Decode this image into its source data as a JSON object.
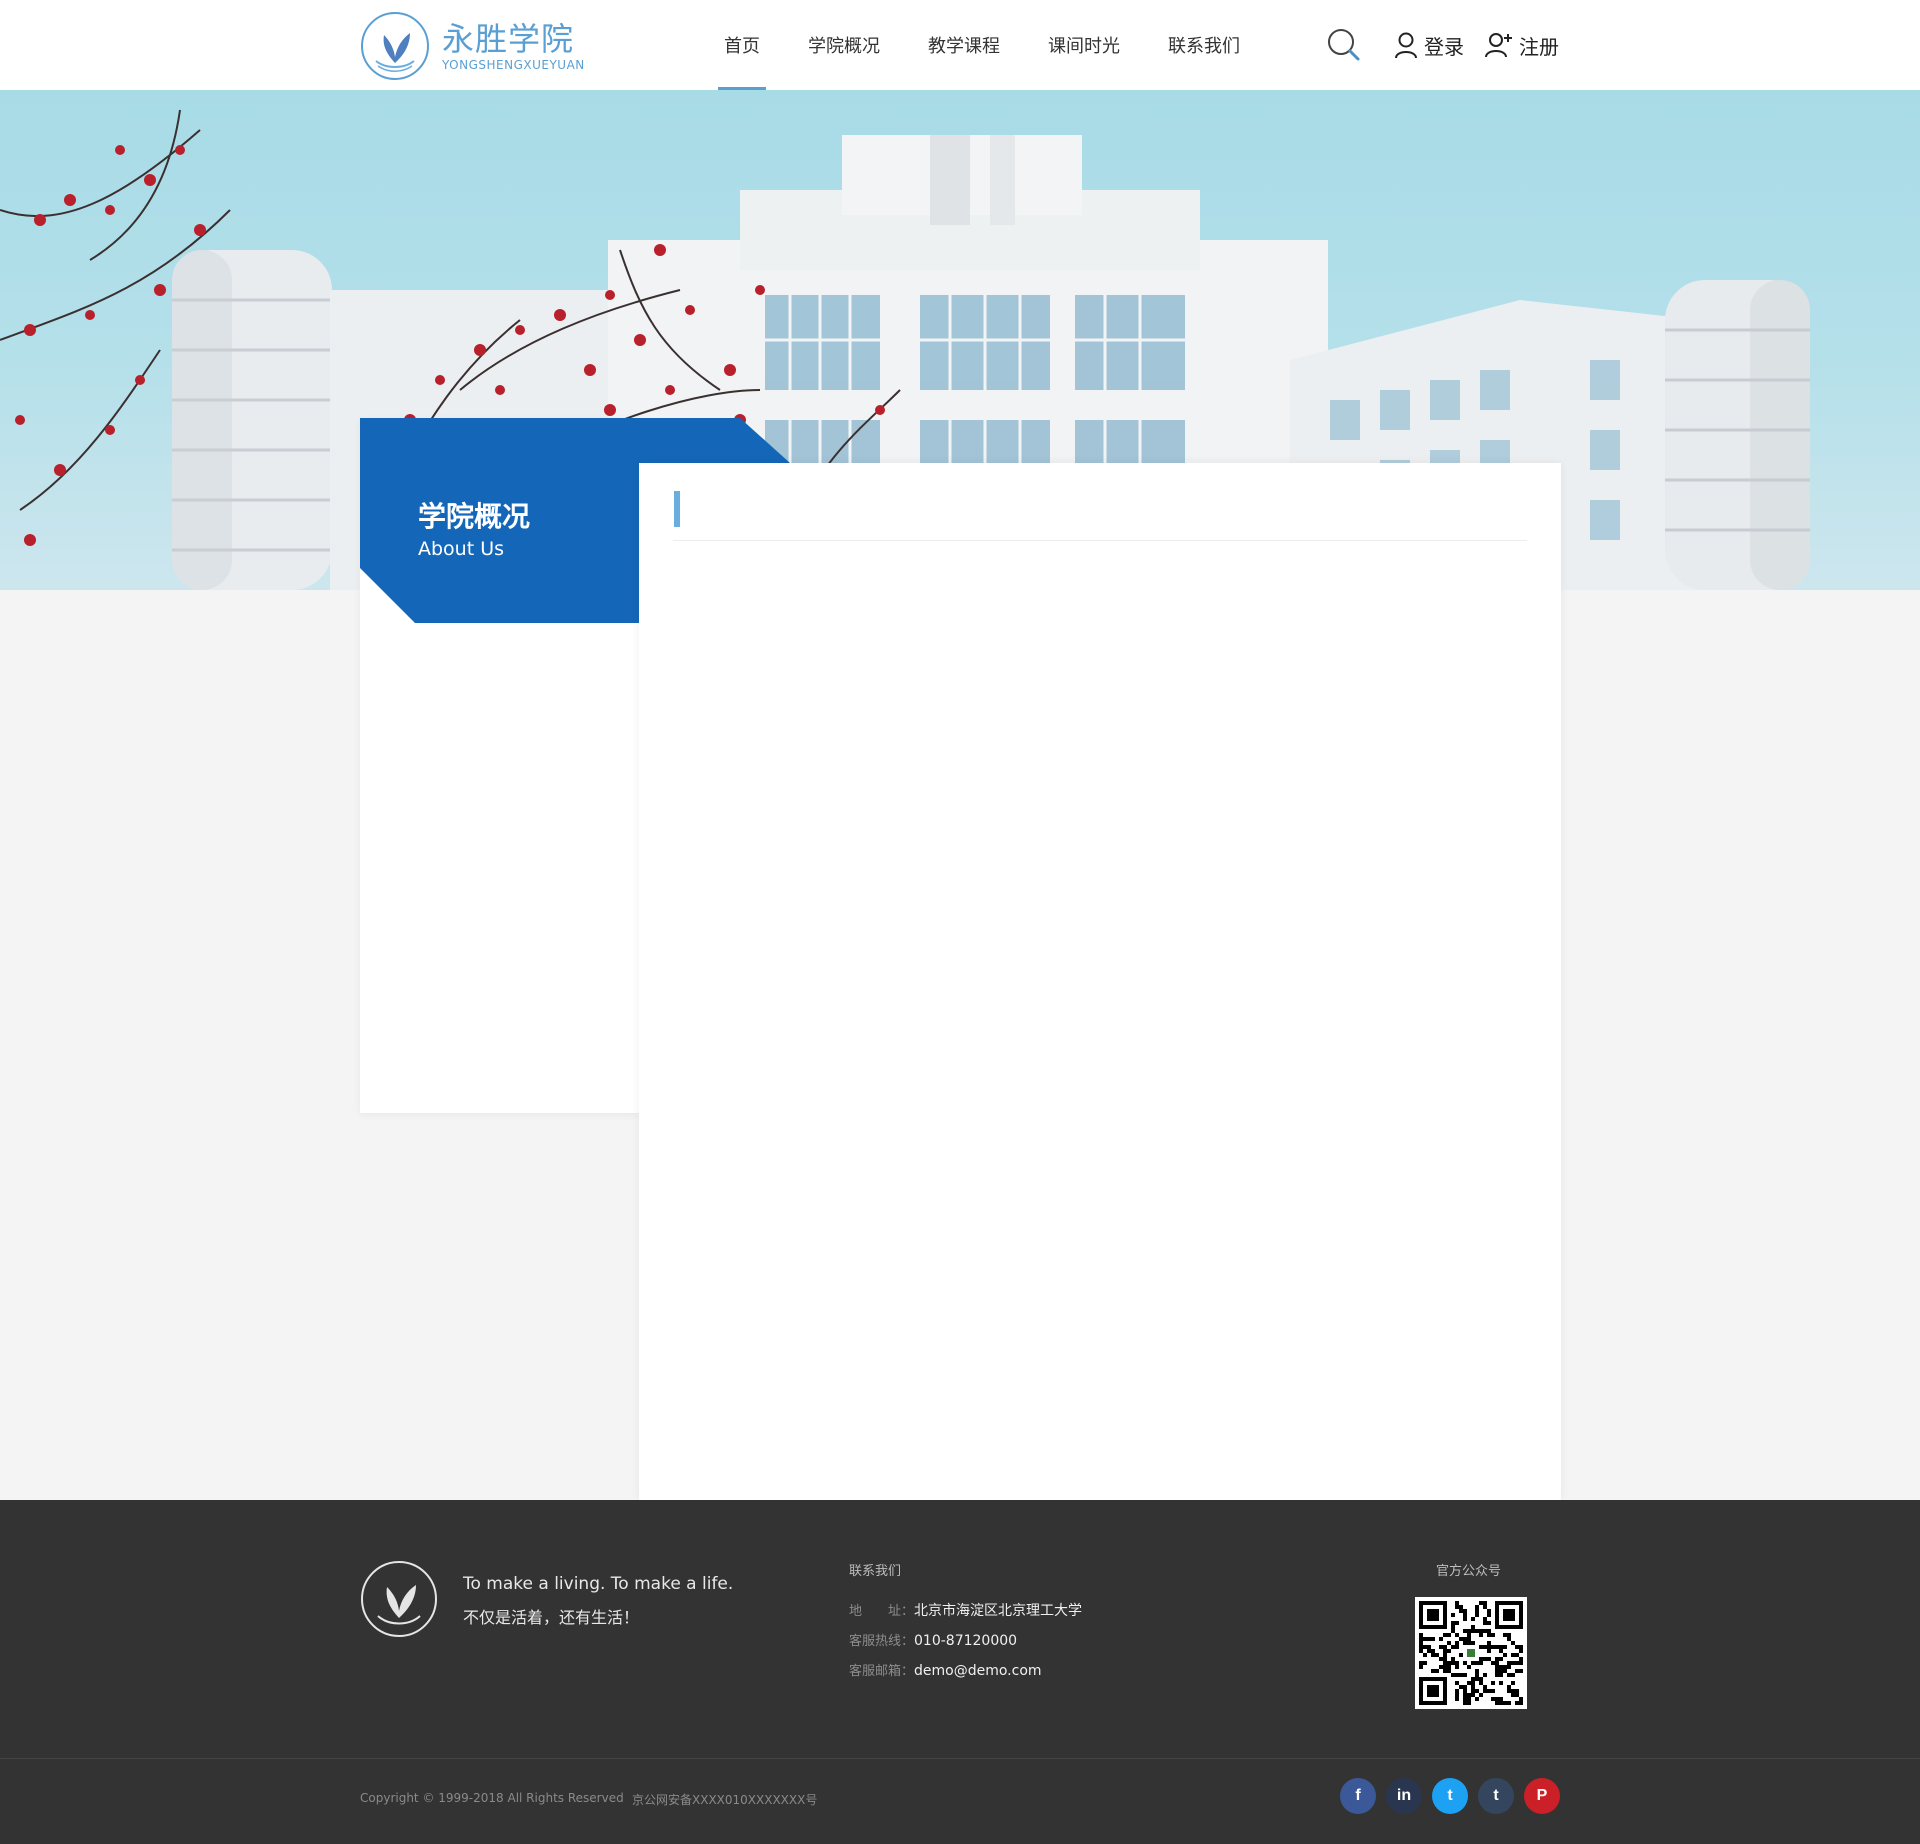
{
  "header": {
    "logo": {
      "cn": "永胜学院",
      "en": "YONGSHENGXUEYUAN"
    },
    "nav": [
      {
        "label": "首页",
        "active": true
      },
      {
        "label": "学院概况",
        "active": false
      },
      {
        "label": "教学课程",
        "active": false
      },
      {
        "label": "课间时光",
        "active": false
      },
      {
        "label": "联系我们",
        "active": false
      }
    ],
    "login_label": "登录",
    "register_label": "注册"
  },
  "sidebar": {
    "title_cn": "学院概况",
    "title_en": "About Us"
  },
  "footer": {
    "slogan_en": "To make a living. To make a life.",
    "slogan_cn": "不仅是活着，还有生活！",
    "contact_title": "联系我们",
    "address_label": "地　　址：",
    "address": "北京市海淀区北京理工大学",
    "hotline_label": "客服热线：",
    "hotline": "010-87120000",
    "email_label": "客服邮箱：",
    "email": "demo@demo.com",
    "qr_title": "官方公众号",
    "copyright": "Copyright © 1999-2018 All Rights Reserved",
    "icp": "京公网安备XXXX010XXXXXXX号",
    "social": [
      {
        "name": "facebook",
        "glyph": "f",
        "color": "#3b5998"
      },
      {
        "name": "linkedin",
        "glyph": "in",
        "color": "#2a3550"
      },
      {
        "name": "twitter",
        "glyph": "t",
        "color": "#1da1f2"
      },
      {
        "name": "tumblr",
        "glyph": "t",
        "color": "#34465d"
      },
      {
        "name": "pinterest",
        "glyph": "P",
        "color": "#cb2027"
      }
    ]
  },
  "colors": {
    "brand": "#5a9fd3",
    "sidebar_blue": "#1467b8",
    "footer_bg": "#333333"
  }
}
